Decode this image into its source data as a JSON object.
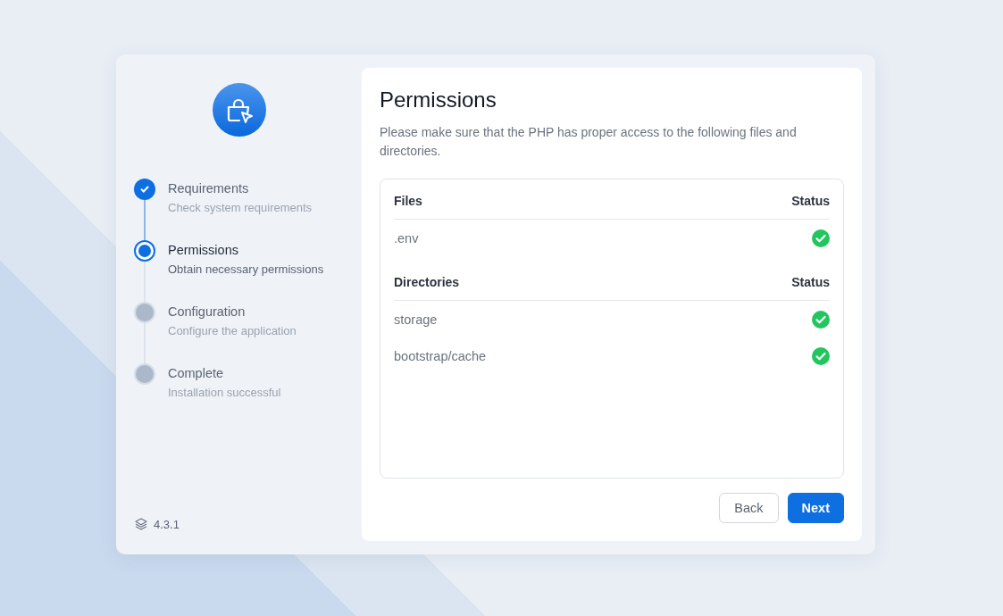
{
  "steps": [
    {
      "title": "Requirements",
      "subtitle": "Check system requirements",
      "kind": "done"
    },
    {
      "title": "Permissions",
      "subtitle": "Obtain necessary permissions",
      "kind": "current"
    },
    {
      "title": "Configuration",
      "subtitle": "Configure the application",
      "kind": "pending"
    },
    {
      "title": "Complete",
      "subtitle": "Installation successful",
      "kind": "pending"
    }
  ],
  "version": "4.3.1",
  "title": "Permissions",
  "description": "Please make sure that the PHP has proper access to the following files and directories.",
  "sections": [
    {
      "heading": "Files",
      "status_heading": "Status",
      "rows": [
        {
          "name": ".env",
          "ok": true
        }
      ]
    },
    {
      "heading": "Directories",
      "status_heading": "Status",
      "rows": [
        {
          "name": "storage",
          "ok": true
        },
        {
          "name": "bootstrap/cache",
          "ok": true
        }
      ]
    }
  ],
  "buttons": [
    {
      "label": "Back",
      "kind": "secondary"
    },
    {
      "label": "Next",
      "kind": "primary"
    }
  ]
}
